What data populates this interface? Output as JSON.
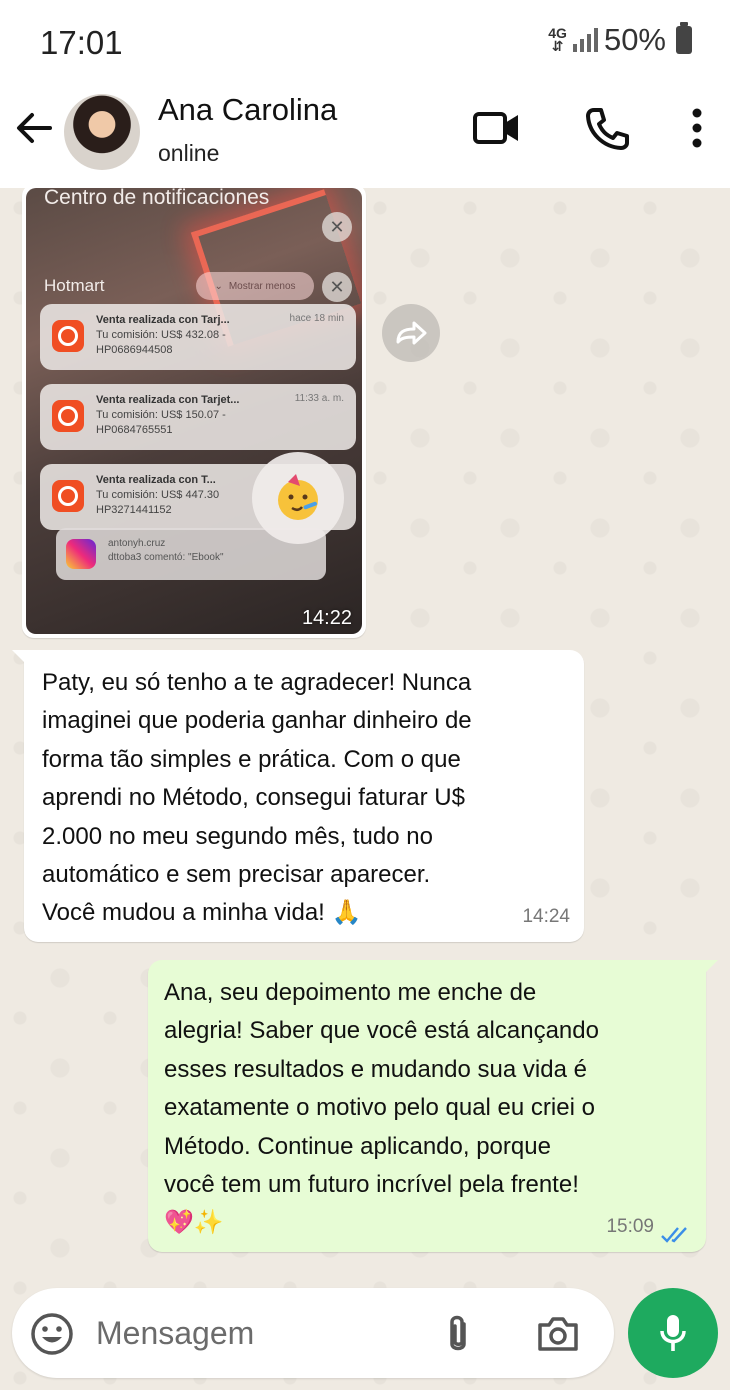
{
  "status_bar": {
    "time": "17:01",
    "network": "4G",
    "battery": "50%"
  },
  "header": {
    "contact_name": "Ana Carolina",
    "contact_status": "online"
  },
  "messages": {
    "image": {
      "time": "14:22",
      "screenshot": {
        "title": "Centro de notificaciones",
        "app": "Hotmart",
        "pill": "Mostrar menos",
        "notifications": [
          {
            "title": "Venta realizada con Tarj...",
            "line1": "Tu comisión: US$ 432.08 -",
            "line2": "HP0686944508",
            "time": "hace 18 min"
          },
          {
            "title": "Venta realizada con Tarjet...",
            "line1": "Tu comisión: US$ 150.07 -",
            "line2": "HP0684765551",
            "time": "11:33 a. m."
          },
          {
            "title": "Venta realizada con T...",
            "line1": "Tu comisión: US$ 447.30",
            "line2": "HP3271441152",
            "time": ""
          }
        ],
        "instagram": {
          "user": "antonyh.cruz",
          "text": "dttoba3 comentó: \"Ebook\""
        }
      }
    },
    "incoming": {
      "lines": [
        "Paty, eu só tenho a te agradecer! Nunca",
        "imaginei que poderia ganhar dinheiro de",
        "forma tão simples e prática. Com o que",
        "aprendi no Método, consegui faturar U$",
        "2.000 no meu segundo mês, tudo no",
        "automático e sem precisar aparecer.",
        "Você mudou a minha vida! 🙏"
      ],
      "time": "14:24"
    },
    "outgoing": {
      "lines": [
        "Ana, seu depoimento me enche de",
        "alegria! Saber que você está alcançando",
        "esses resultados e mudando sua vida é",
        "exatamente o motivo pelo qual eu criei o",
        "Método. Continue aplicando, porque",
        "você tem um futuro incrível pela frente!",
        "💖✨"
      ],
      "time": "15:09"
    }
  },
  "input": {
    "placeholder": "Mensagem"
  },
  "colors": {
    "outgoing_bubble": "#e7fcd5",
    "chat_background": "#efeae2",
    "mic_button": "#1eaa5f",
    "read_ticks": "#3b8ee8"
  }
}
